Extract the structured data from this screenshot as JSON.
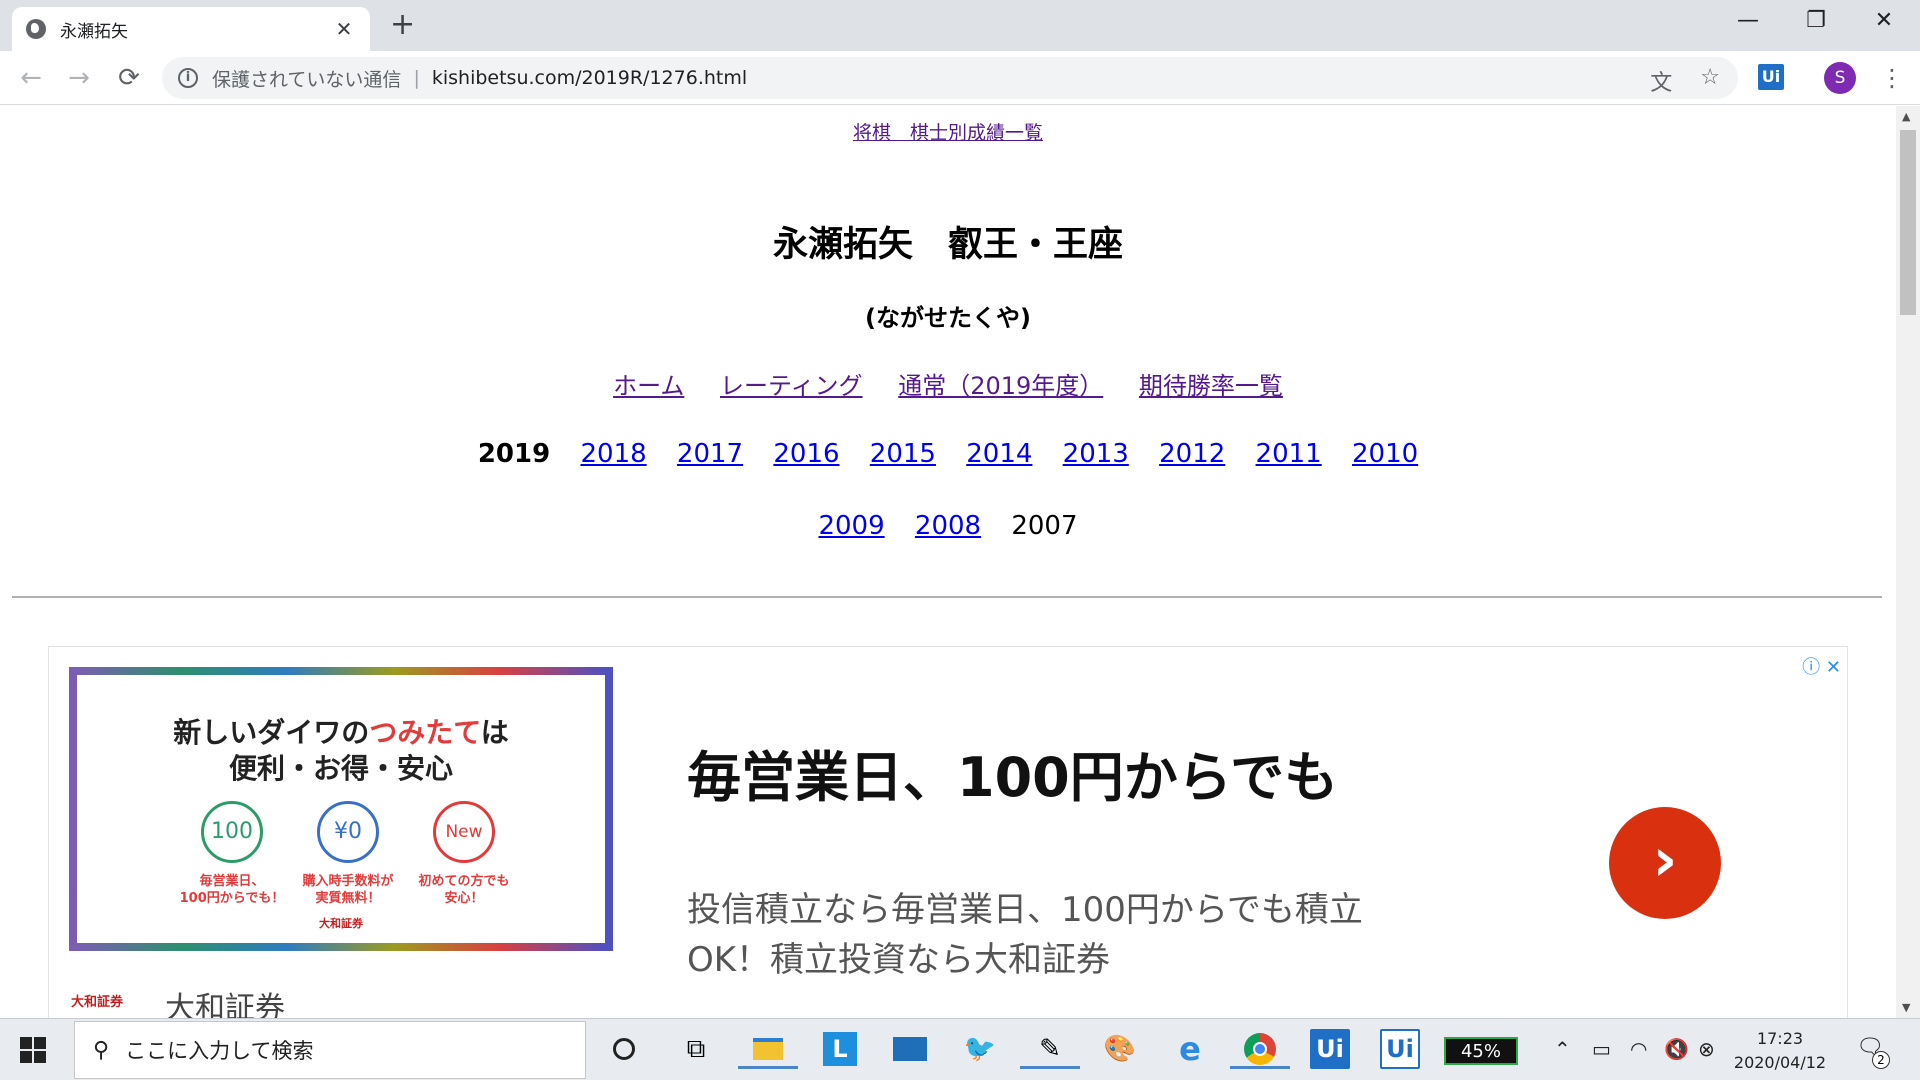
{
  "browser": {
    "tab_title": "永瀬拓矢",
    "new_tab": "+",
    "minimize": "—",
    "restore": "❐",
    "close": "✕",
    "back": "←",
    "forward": "→",
    "reload": "⟳",
    "insecure_label": "保護されていない通信",
    "separator": "|",
    "url": "kishibetsu.com/2019R/1276.html",
    "translate_icon": "文",
    "star_icon": "☆",
    "extension": "Ui",
    "profile_initial": "S",
    "menu_icon": "⋮"
  },
  "page": {
    "top_link": "将棋　棋士別成績一覧",
    "name_title": "永瀬拓矢　叡王・王座",
    "kana": "(ながせたくや)",
    "menu": [
      "ホーム",
      "レーティング",
      "通常（2019年度）",
      "期待勝率一覧"
    ],
    "years_row1": {
      "current": "2019",
      "links": [
        "2018",
        "2017",
        "2016",
        "2015",
        "2014",
        "2013",
        "2012",
        "2011",
        "2010"
      ]
    },
    "years_row2": {
      "links": [
        "2009",
        "2008"
      ],
      "plain": "2007"
    }
  },
  "ad": {
    "info_icon": "ⓘ",
    "close_icon": "✕",
    "image_title_line1_pre": "新しいダイワの",
    "image_title_line1_red": "つみたて",
    "image_title_line1_post": "は",
    "image_title_line2": "便利・お得・安心",
    "circles": [
      {
        "label": "100",
        "caption": "毎営業日、\n100円からでも！"
      },
      {
        "label": "¥0",
        "caption": "購入時手数料が\n実質無料！"
      },
      {
        "label": "New",
        "caption": "初めての方でも\n安心！"
      }
    ],
    "image_brand": "大和証券",
    "headline": "毎営業日、100円からでも",
    "desc_line1": "投信積立なら毎営業日、100円からでも積立",
    "desc_line2": "OK！積立投資なら大和証券",
    "cta": "›",
    "brand_logo": "大和証券",
    "brand_name": "大和証券"
  },
  "taskbar": {
    "search_placeholder": "ここに入力して検索",
    "battery": "45%",
    "time": "17:23",
    "date": "2020/04/12",
    "notification_count": "2",
    "ui1": "Ui",
    "ui2": "Ui",
    "launcher_l": "L"
  }
}
